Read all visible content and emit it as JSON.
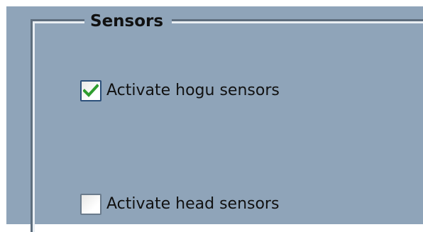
{
  "sensors_group": {
    "title": "Sensors",
    "options": [
      {
        "label": "Activate hogu sensors",
        "checked": true
      },
      {
        "label": "Activate head sensors",
        "checked": false
      }
    ]
  },
  "colors": {
    "panel_background": "#8fa4b9",
    "checkmark": "#2f9d2f"
  },
  "icons": {
    "checked_mark": "checkmark-icon"
  }
}
